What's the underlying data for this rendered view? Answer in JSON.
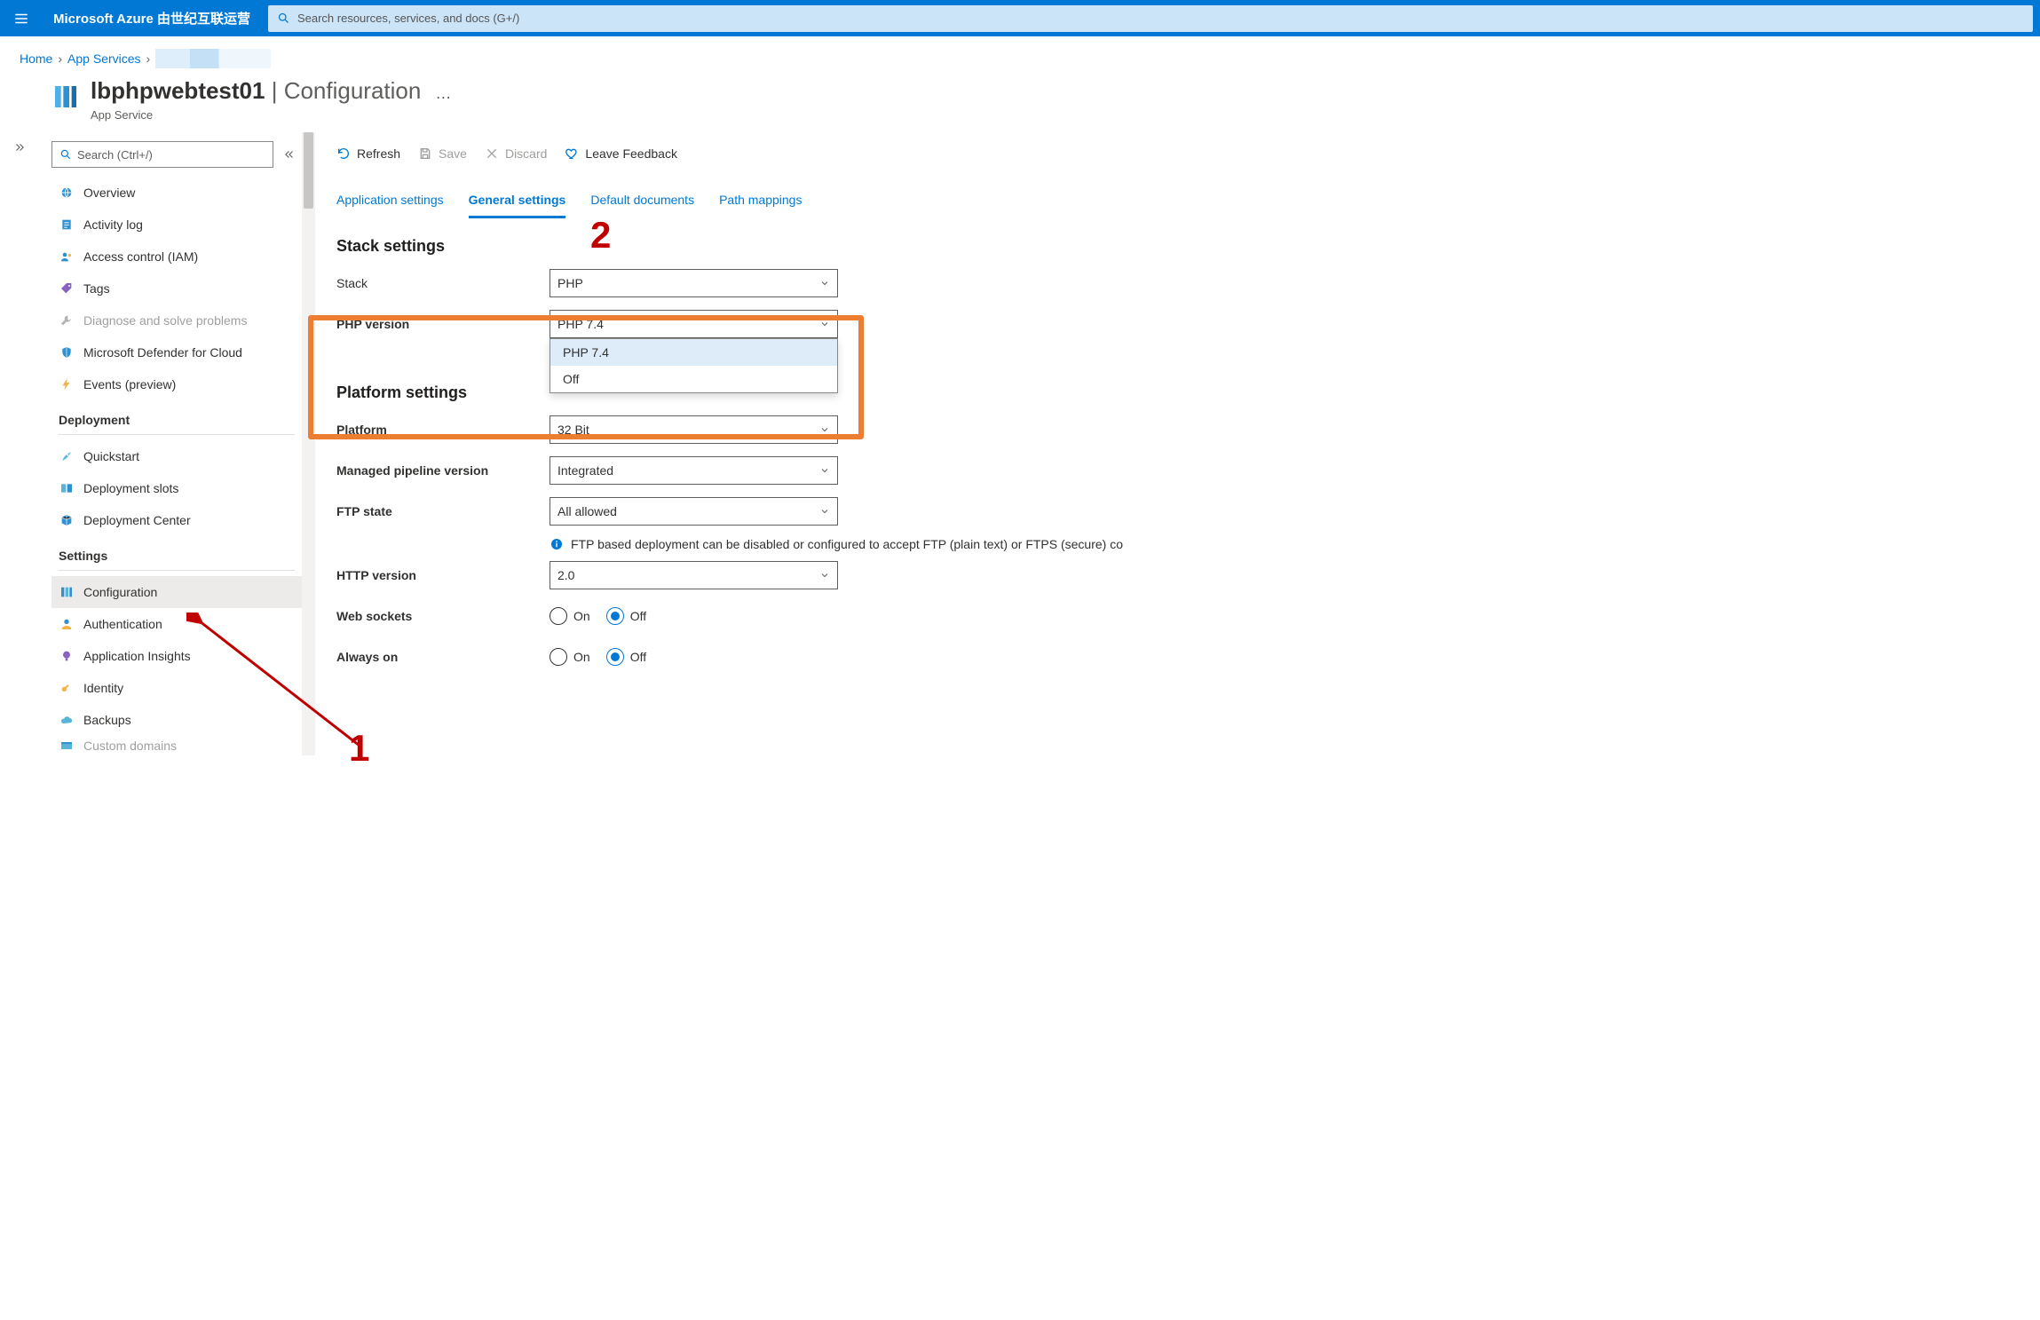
{
  "header": {
    "brand": "Microsoft Azure 由世纪互联运营",
    "search_placeholder": "Search resources, services, and docs (G+/)"
  },
  "breadcrumb": {
    "home": "Home",
    "app_services": "App Services"
  },
  "page_header": {
    "title_main": "lbphpwebtest01",
    "title_sep": " | ",
    "title_sub": "Configuration",
    "subtitle": "App Service",
    "more": "…"
  },
  "sidebar": {
    "search_placeholder": "Search (Ctrl+/)",
    "items_top": [
      {
        "label": "Overview",
        "icon": "globe"
      },
      {
        "label": "Activity log",
        "icon": "log"
      },
      {
        "label": "Access control (IAM)",
        "icon": "iam"
      },
      {
        "label": "Tags",
        "icon": "tag"
      },
      {
        "label": "Diagnose and solve problems",
        "icon": "wrench",
        "muted": true
      },
      {
        "label": "Microsoft Defender for Cloud",
        "icon": "shield"
      },
      {
        "label": "Events (preview)",
        "icon": "bolt"
      }
    ],
    "group_deployment": "Deployment",
    "items_deployment": [
      {
        "label": "Quickstart",
        "icon": "rocket"
      },
      {
        "label": "Deployment slots",
        "icon": "slots"
      },
      {
        "label": "Deployment Center",
        "icon": "cube"
      }
    ],
    "group_settings": "Settings",
    "items_settings": [
      {
        "label": "Configuration",
        "icon": "sliders",
        "selected": true
      },
      {
        "label": "Authentication",
        "icon": "user"
      },
      {
        "label": "Application Insights",
        "icon": "bulb"
      },
      {
        "label": "Identity",
        "icon": "key"
      },
      {
        "label": "Backups",
        "icon": "cloud"
      },
      {
        "label": "Custom domains",
        "icon": "domain",
        "cut": true
      }
    ]
  },
  "toolbar": {
    "refresh": "Refresh",
    "save": "Save",
    "discard": "Discard",
    "feedback": "Leave Feedback"
  },
  "tabs": {
    "application_settings": "Application settings",
    "general_settings": "General settings",
    "default_documents": "Default documents",
    "path_mappings": "Path mappings"
  },
  "sections": {
    "stack": "Stack settings",
    "platform": "Platform settings"
  },
  "fields": {
    "stack": {
      "label": "Stack",
      "value": "PHP"
    },
    "php_version": {
      "label": "PHP version",
      "value": "PHP 7.4",
      "options": [
        "PHP 7.4",
        "Off"
      ]
    },
    "platform": {
      "label": "Platform",
      "value": "32 Bit"
    },
    "managed_pipeline": {
      "label": "Managed pipeline version",
      "value": "Integrated"
    },
    "ftp_state": {
      "label": "FTP state",
      "value": "All allowed",
      "info": "FTP based deployment can be disabled or configured to accept FTP (plain text) or FTPS (secure) co"
    },
    "http_version": {
      "label": "HTTP version",
      "value": "2.0"
    },
    "web_sockets": {
      "label": "Web sockets",
      "on": "On",
      "off": "Off",
      "value": "Off"
    },
    "always_on": {
      "label": "Always on",
      "on": "On",
      "off": "Off",
      "value": "Off"
    }
  },
  "annotations": {
    "one": "1",
    "two": "2"
  }
}
